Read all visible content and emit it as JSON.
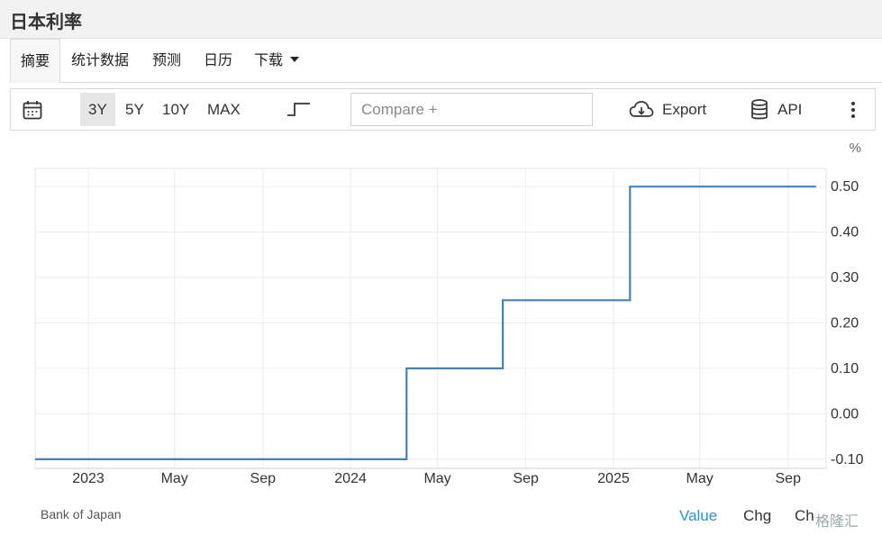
{
  "page": {
    "title": "日本利率"
  },
  "tabs": [
    {
      "label": "摘要",
      "active": true
    },
    {
      "label": "统计数据"
    },
    {
      "label": "预测"
    },
    {
      "label": "日历"
    },
    {
      "label": "下载"
    }
  ],
  "toolbar": {
    "ranges": [
      "3Y",
      "5Y",
      "10Y",
      "MAX"
    ],
    "active_range": "3Y",
    "compare_placeholder": "Compare +",
    "export_label": "Export",
    "api_label": "API",
    "icons": [
      "calendar-icon",
      "step-line-icon",
      "cloud-download-icon",
      "database-icon",
      "more-vertical-icon"
    ]
  },
  "footer": {
    "source": "Bank of Japan",
    "tabs": [
      "Value",
      "Chg",
      "Ch"
    ],
    "active_tab": "Value",
    "watermark": "格隆汇"
  },
  "colors": {
    "line": "#4a7fb5",
    "accent": "#2f8fd0"
  },
  "chart_data": {
    "type": "line",
    "step": true,
    "ylabel": "%",
    "y_axis_position": "right",
    "grid": true,
    "ylim": [
      -0.12,
      0.54
    ],
    "yticks": [
      -0.1,
      0.0,
      0.1,
      0.2,
      0.3,
      0.4,
      0.5
    ],
    "ytick_labels": [
      "-0.10",
      "0.00",
      "0.10",
      "0.20",
      "0.30",
      "0.40",
      "0.50"
    ],
    "xlim": [
      "2022-10-19",
      "2025-10-24"
    ],
    "xticks": [
      "2023-01-01",
      "2023-05-01",
      "2023-09-01",
      "2024-01-01",
      "2024-05-01",
      "2024-09-01",
      "2025-01-01",
      "2025-05-01",
      "2025-09-01"
    ],
    "xtick_labels": [
      "2023",
      "May",
      "Sep",
      "2024",
      "May",
      "Sep",
      "2025",
      "May",
      "Sep"
    ],
    "series": [
      {
        "points": [
          [
            "2022-10-19",
            -0.1
          ],
          [
            "2024-03-19",
            -0.1
          ],
          [
            "2024-03-19",
            0.1
          ],
          [
            "2024-07-31",
            0.1
          ],
          [
            "2024-07-31",
            0.25
          ],
          [
            "2025-01-24",
            0.25
          ],
          [
            "2025-01-24",
            0.5
          ],
          [
            "2025-10-10",
            0.5
          ]
        ]
      }
    ]
  }
}
